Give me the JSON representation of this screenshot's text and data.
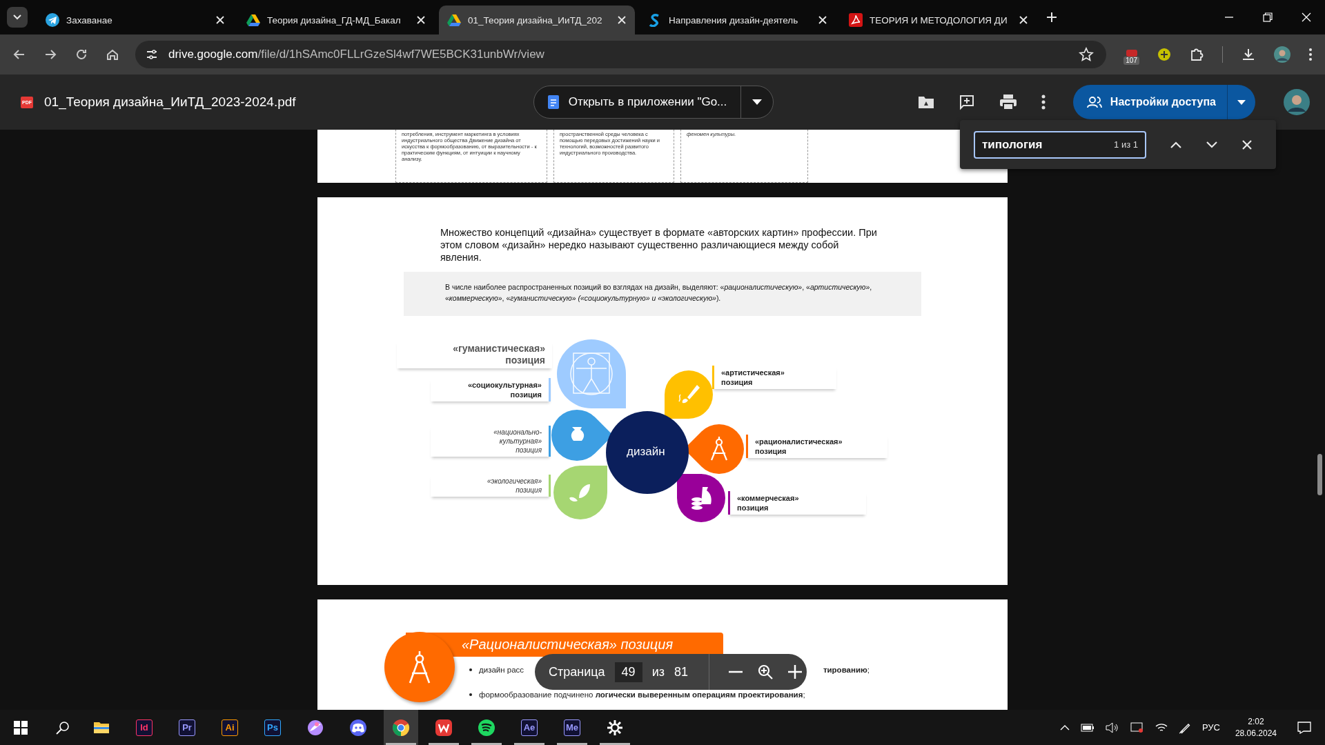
{
  "browser": {
    "tabs": [
      {
        "title": "Захаванае",
        "selected": false
      },
      {
        "title": "Теория дизайна_ГД-МД_Бакал",
        "selected": false
      },
      {
        "title": "01_Теория дизайна_ИиТД_202",
        "selected": true
      },
      {
        "title": "Направления дизайн-деятель",
        "selected": false
      },
      {
        "title": "ТЕОРИЯ И МЕТОДОЛОГИЯ ДИ",
        "selected": false
      }
    ],
    "address": {
      "domain": "drive.google.com",
      "path": "/file/d/1hSAmc0FLLrGzeSl4wf7WE5BCK31unbWr/view"
    },
    "extension_badge": "107"
  },
  "viewer": {
    "file_badge": "PDF",
    "file_name": "01_Теория дизайна_ИиТД_2023-2024.pdf",
    "open_button": "Открыть в приложении \"Go...",
    "share_button": "Настройки доступа",
    "find": {
      "value": "типология",
      "count": "1 из 1"
    },
    "page_nav": {
      "label": "Страница",
      "page": "49",
      "of": "из",
      "total": "81"
    }
  },
  "pages": [
    {
      "kind": "cards",
      "cards": [
        {
          "text": "потребления, инструмент маркетинга в условиях индустриального общества Движение дизайна от искусства к формообразованию, от выразительности - к практическим функциям, от интуиции к научному анализу.",
          "italic": false
        },
        {
          "text": "пространственной среды человека с помощью передовых достижений науки и технологий, возможностей развитого индустриального производства.",
          "italic": false
        },
        {
          "text": "феномен культуры.",
          "italic": true
        }
      ]
    },
    {
      "kind": "diagram",
      "paragraph": "Множество концепций «дизайна» существует в формате «авторских картин» профессии. При этом словом «дизайн» нередко называют существенно различающиеся между собой явления.",
      "note": "В числе наиболее распространенных позиций во взглядах на дизайн, выделяют: «*рационалистическую*», «*артистическую*», «*коммерческую*», «*гуманистическую*» *(«социокультурную» и «экологическую»*).",
      "center": "дизайн",
      "petals": [
        {
          "color": "#9ecbff"
        },
        {
          "color": "#3d9fe3"
        },
        {
          "color": "#a6d672"
        },
        {
          "color": "#ffc000"
        },
        {
          "color": "#ff6a00"
        },
        {
          "color": "#990099"
        }
      ],
      "labels": [
        {
          "text": "«гуманистическая» позиция",
          "kind": "heading"
        },
        {
          "text": "«социокультурная» позиция",
          "kind": "bold",
          "color": "#9ecbff"
        },
        {
          "text": "«национально-культурная» позиция",
          "kind": "italic",
          "color": "#3d9fe3"
        },
        {
          "text": "«экологическая» позиция",
          "kind": "italic",
          "color": "#a6d672"
        },
        {
          "text": "«артистическая» позиция",
          "kind": "bold",
          "color": "#ffc000"
        },
        {
          "text": "«рационалистическая» позиция",
          "kind": "bold",
          "color": "#ff6a00"
        },
        {
          "text": "«коммерческая» позиция",
          "kind": "bold",
          "color": "#990099"
        }
      ]
    },
    {
      "kind": "position",
      "title": "«Рационалистическая» позиция",
      "bullets": [
        {
          "start": "дизайн расс",
          "end": "**тированию**;"
        },
        {
          "start": "формообразование подчинено **логически выверенным операциям проектирования**;"
        }
      ]
    }
  ],
  "taskbar": {
    "apps": [
      {
        "kind": "folder",
        "running": false,
        "selected": false
      },
      {
        "kind": "badge",
        "label": "Id",
        "color": "#ff3366",
        "running": false,
        "selected": false
      },
      {
        "kind": "badge",
        "label": "Pr",
        "color": "#9999ff",
        "running": false,
        "selected": false
      },
      {
        "kind": "badge",
        "label": "Ai",
        "color": "#ff9a00",
        "running": false,
        "selected": false
      },
      {
        "kind": "badge",
        "label": "Ps",
        "color": "#31a8ff",
        "running": false,
        "selected": false
      },
      {
        "kind": "paint",
        "running": false,
        "selected": false
      },
      {
        "kind": "chat",
        "running": false,
        "selected": false
      },
      {
        "kind": "browser",
        "running": true,
        "selected": true
      },
      {
        "kind": "office",
        "running": true,
        "selected": false
      },
      {
        "kind": "music",
        "running": true,
        "selected": false
      },
      {
        "kind": "badge",
        "label": "Ae",
        "color": "#9999ff",
        "running": true,
        "selected": false
      },
      {
        "kind": "badge",
        "label": "Me",
        "color": "#9999ff",
        "running": true,
        "selected": false
      },
      {
        "kind": "gear",
        "running": true,
        "selected": false
      }
    ],
    "language": "РУС",
    "time": "2:02",
    "date": "28.06.2024"
  }
}
